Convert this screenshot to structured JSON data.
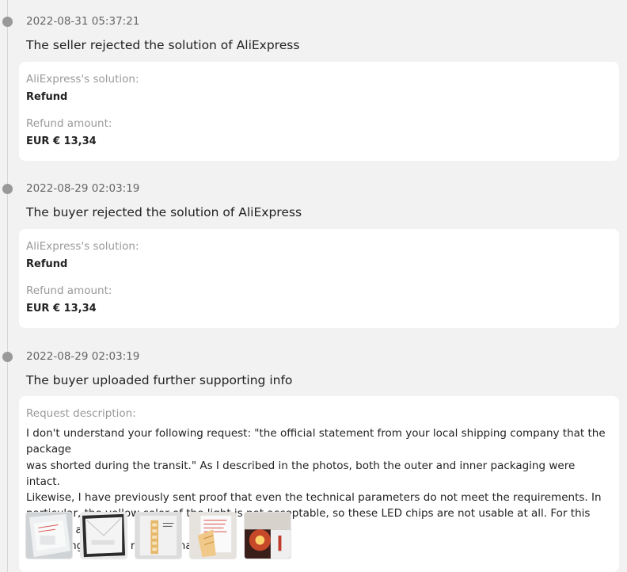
{
  "timeline": [
    {
      "timestamp": "2022-08-31 05:37:21",
      "title": "The seller rejected the solution of AliExpress",
      "solution_label": "AliExpress's solution:",
      "solution_value": "Refund",
      "amount_label": "Refund amount:",
      "amount_value": "EUR € 13,34"
    },
    {
      "timestamp": "2022-08-29 02:03:19",
      "title": "The buyer rejected the solution of AliExpress",
      "solution_label": "AliExpress's solution:",
      "solution_value": "Refund",
      "amount_label": "Refund amount:",
      "amount_value": "EUR € 13,34"
    },
    {
      "timestamp": "2022-08-29 02:03:19",
      "title": "The buyer uploaded further supporting info",
      "description_label": "Request description:",
      "description_lines": [
        "I don't understand your following request: \"the official statement from your local shipping company that the package",
        "was shorted during the transit.\" As I described in the photos, both the outer and inner packaging were intact.",
        "Likewise, I have previously sent proof that even the technical parameters do not meet the requirements. In",
        "particular, the yellow color of the light is not acceptable, so these LED chips are not usable at all. For this reason, I am",
        "requesting a 100% refund. Thanks!"
      ],
      "attachments": [
        "package-photo-icon",
        "envelope-photo-icon",
        "chip-strip-photo-icon",
        "handwritten-label-photo-icon",
        "lit-led-photo-icon"
      ]
    }
  ],
  "colors": {
    "background": "#f2f2f2",
    "card": "#ffffff",
    "dot": "#999999",
    "label": "#999999",
    "text": "#222222"
  }
}
